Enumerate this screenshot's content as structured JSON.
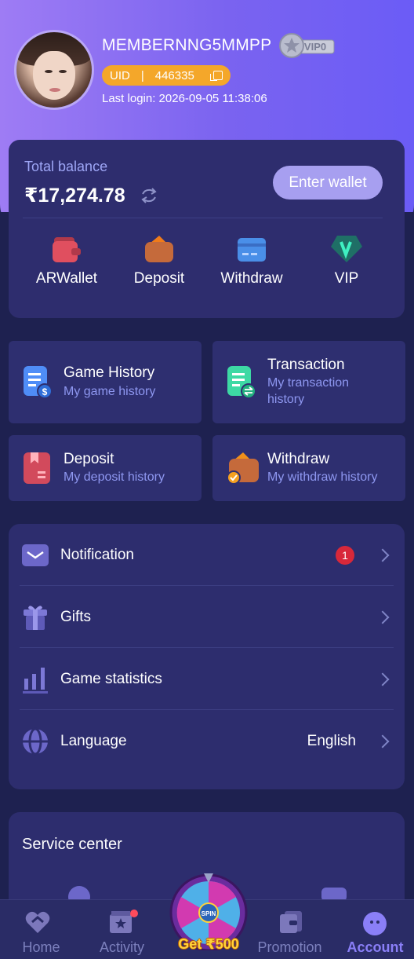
{
  "profile": {
    "username": "MEMBERNNG5MMPP",
    "vip_badge": "VIP0",
    "uid_label": "UID",
    "uid_sep": "|",
    "uid_value": "446335",
    "last_login": "Last login: 2026-09-05 11:38:06"
  },
  "balance": {
    "title": "Total balance",
    "amount": "₹17,274.78",
    "enter_wallet": "Enter wallet"
  },
  "quick_actions": [
    {
      "label": "ARWallet",
      "icon": "arwallet-icon"
    },
    {
      "label": "Deposit",
      "icon": "deposit-icon"
    },
    {
      "label": "Withdraw",
      "icon": "withdraw-icon"
    },
    {
      "label": "VIP",
      "icon": "vip-icon"
    }
  ],
  "history": [
    {
      "title": "Game History",
      "subtitle": "My game history"
    },
    {
      "title": "Transaction",
      "subtitle": "My transaction history"
    },
    {
      "title": "Deposit",
      "subtitle": "My deposit history"
    },
    {
      "title": "Withdraw",
      "subtitle": "My withdraw history"
    }
  ],
  "menu": {
    "notification": {
      "label": "Notification",
      "badge": "1"
    },
    "gifts": {
      "label": "Gifts"
    },
    "game_statistics": {
      "label": "Game statistics"
    },
    "language": {
      "label": "Language",
      "value": "English"
    }
  },
  "service": {
    "title": "Service center"
  },
  "tabbar": {
    "home": "Home",
    "activity": "Activity",
    "spin": "Get ₹500",
    "spin_text": "SPIN",
    "promotion": "Promotion",
    "account": "Account"
  },
  "colors": {
    "accent": "#8a7ff7",
    "uid_pill": "#f4a72a",
    "badge": "#d8283a",
    "background": "#22275b"
  }
}
